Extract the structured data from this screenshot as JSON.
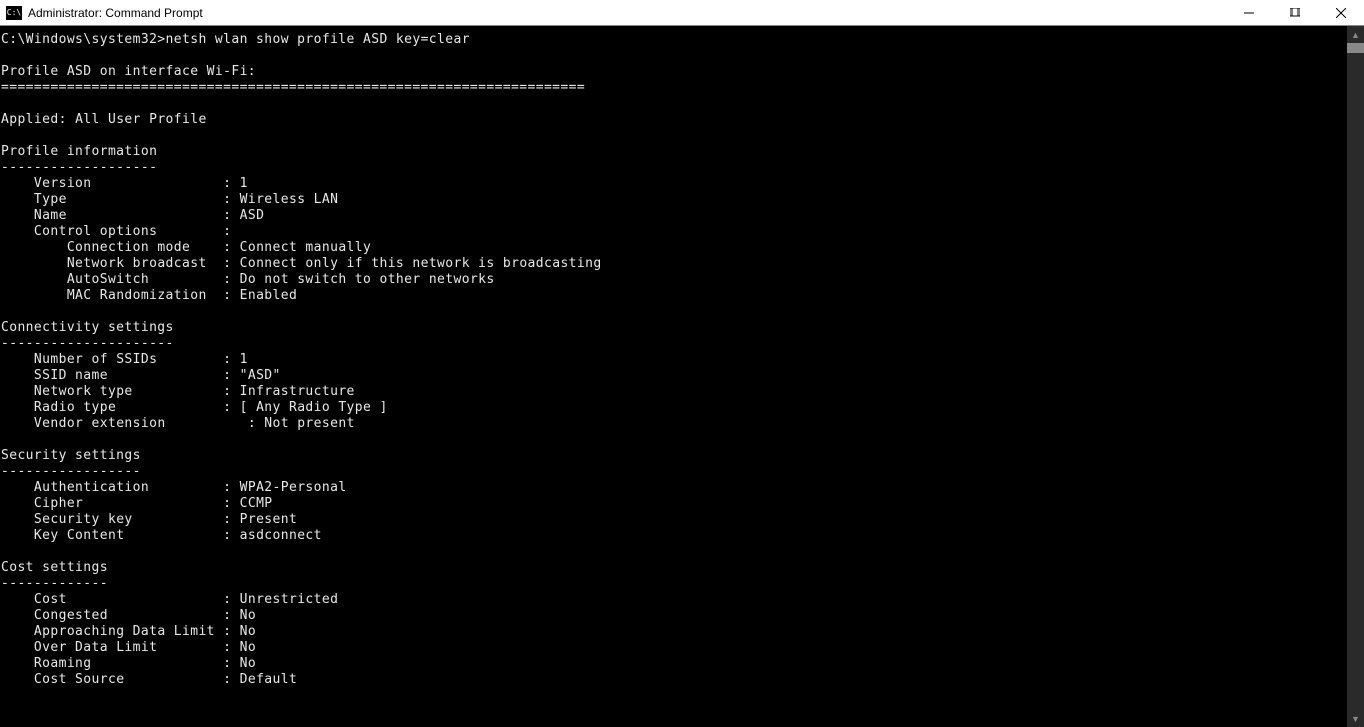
{
  "window": {
    "icon_text": "C:\\",
    "title": "Administrator: Command Prompt"
  },
  "terminal": {
    "prompt": "C:\\Windows\\system32>",
    "command": "netsh wlan show profile ASD key=clear",
    "profile_header": "Profile ASD on interface Wi-Fi:",
    "separator": "=======================================================================",
    "applied_label": "Applied:",
    "applied_value": "All User Profile",
    "sections": {
      "profile_info": {
        "title": "Profile information",
        "divider": "-------------------",
        "rows": {
          "version_label": "Version",
          "version_value": "1",
          "type_label": "Type",
          "type_value": "Wireless LAN",
          "name_label": "Name",
          "name_value": "ASD",
          "control_label": "Control options",
          "conn_mode_label": "Connection mode",
          "conn_mode_value": "Connect manually",
          "net_broadcast_label": "Network broadcast",
          "net_broadcast_value": "Connect only if this network is broadcasting",
          "autoswitch_label": "AutoSwitch",
          "autoswitch_value": "Do not switch to other networks",
          "mac_rand_label": "MAC Randomization",
          "mac_rand_value": "Enabled"
        }
      },
      "connectivity": {
        "title": "Connectivity settings",
        "divider": "---------------------",
        "rows": {
          "num_ssids_label": "Number of SSIDs",
          "num_ssids_value": "1",
          "ssid_name_label": "SSID name",
          "ssid_name_value": "\"ASD\"",
          "net_type_label": "Network type",
          "net_type_value": "Infrastructure",
          "radio_type_label": "Radio type",
          "radio_type_value": "[ Any Radio Type ]",
          "vendor_ext_label": "Vendor extension",
          "vendor_ext_value": "Not present"
        }
      },
      "security": {
        "title": "Security settings",
        "divider": "-----------------",
        "rows": {
          "auth_label": "Authentication",
          "auth_value": "WPA2-Personal",
          "cipher_label": "Cipher",
          "cipher_value": "CCMP",
          "seckey_label": "Security key",
          "seckey_value": "Present",
          "keycontent_label": "Key Content",
          "keycontent_value": "asdconnect"
        }
      },
      "cost": {
        "title": "Cost settings",
        "divider": "-------------",
        "rows": {
          "cost_label": "Cost",
          "cost_value": "Unrestricted",
          "congested_label": "Congested",
          "congested_value": "No",
          "approach_label": "Approaching Data Limit",
          "approach_value": "No",
          "over_label": "Over Data Limit",
          "over_value": "No",
          "roaming_label": "Roaming",
          "roaming_value": "No",
          "src_label": "Cost Source",
          "src_value": "Default"
        }
      }
    }
  }
}
